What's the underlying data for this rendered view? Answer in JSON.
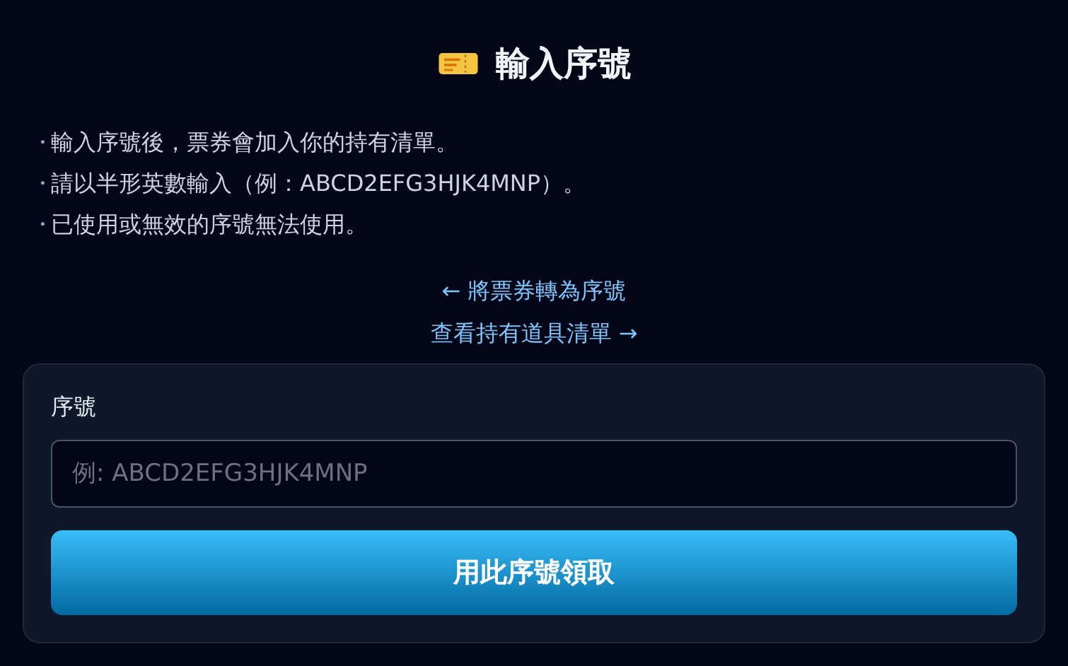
{
  "title": "輸入序號",
  "notes": [
    {
      "bullet": "・",
      "text": "輸入序號後，票券會加入你的持有清單。"
    },
    {
      "bullet": "・",
      "text": "請以半形英數輸入（例：ABCD2EFG3HJK4MNP）。"
    },
    {
      "bullet": "・",
      "text": "已使用或無效的序號無法使用。"
    }
  ],
  "links": [
    "← 將票券轉為序號",
    "查看持有道具清單 →"
  ],
  "form": {
    "label": "序號",
    "placeholder": "例: ABCD2EFG3HJK4MNP",
    "button": "用此序號領取"
  }
}
